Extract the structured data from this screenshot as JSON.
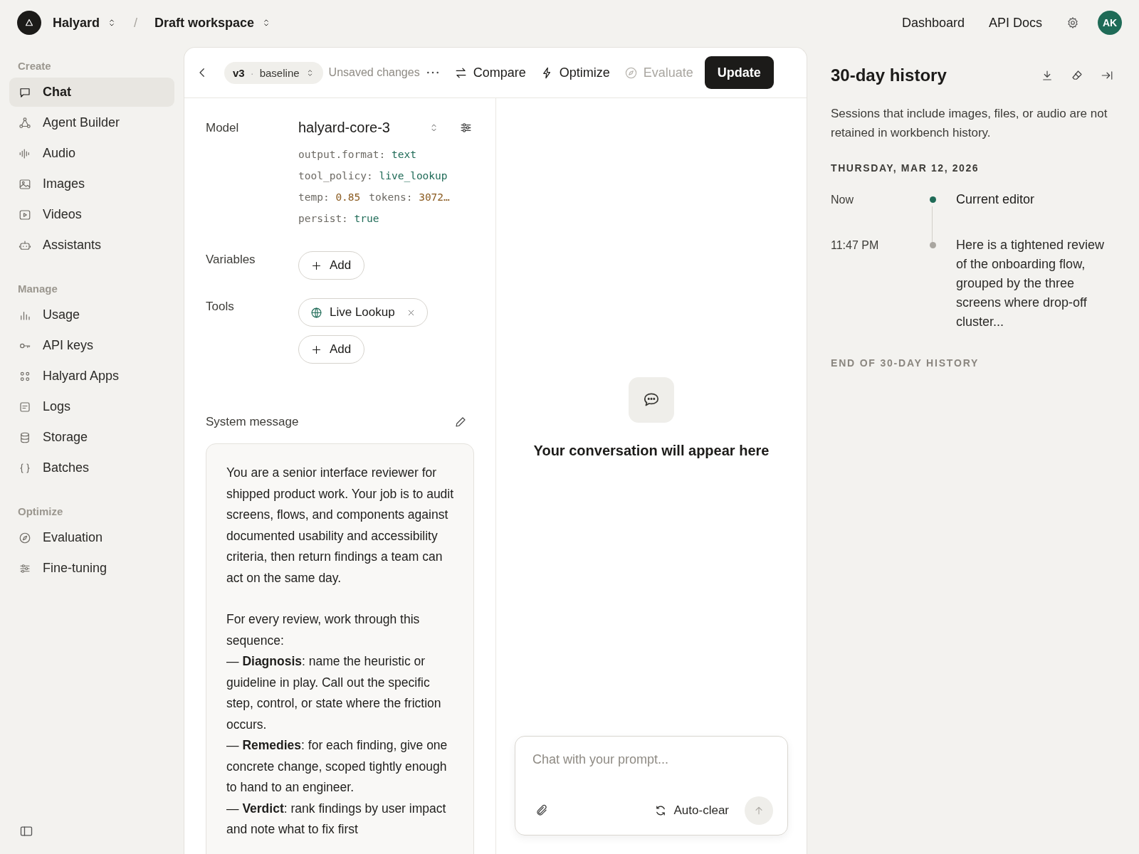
{
  "topbar": {
    "org": "Halyard",
    "separator": "/",
    "workspace": "Draft workspace",
    "links": [
      "Dashboard",
      "API Docs"
    ],
    "avatar": "AK"
  },
  "sidebar": {
    "sections": [
      {
        "title": "Create",
        "items": [
          {
            "label": "Chat",
            "selected": true
          },
          {
            "label": "Agent Builder",
            "selected": false
          },
          {
            "label": "Audio",
            "selected": false
          },
          {
            "label": "Images",
            "selected": false
          },
          {
            "label": "Videos",
            "selected": false
          },
          {
            "label": "Assistants",
            "selected": false
          }
        ]
      },
      {
        "title": "Manage",
        "items": [
          {
            "label": "Usage",
            "selected": false
          },
          {
            "label": "API keys",
            "selected": false
          },
          {
            "label": "Halyard Apps",
            "selected": false
          },
          {
            "label": "Logs",
            "selected": false
          },
          {
            "label": "Storage",
            "selected": false
          },
          {
            "label": "Batches",
            "selected": false
          }
        ]
      },
      {
        "title": "Optimize",
        "items": [
          {
            "label": "Evaluation",
            "selected": false
          },
          {
            "label": "Fine-tuning",
            "selected": false
          }
        ]
      }
    ]
  },
  "toolbar": {
    "version": "v3",
    "version_separator": "·",
    "branch": "baseline",
    "status": "Unsaved changes",
    "actions": [
      {
        "label": "Compare",
        "disabled": false
      },
      {
        "label": "Optimize",
        "disabled": false
      },
      {
        "label": "Evaluate",
        "disabled": true
      }
    ],
    "primary": "Update"
  },
  "config": {
    "model_label": "Model",
    "model": "halyard-core-3",
    "params": [
      [
        {
          "key": "output.format:",
          "value": "text",
          "kind": "string"
        }
      ],
      [
        {
          "key": "tool_policy:",
          "value": "live_lookup",
          "kind": "string"
        }
      ],
      [
        {
          "key": "temp:",
          "value": "0.85",
          "kind": "number"
        },
        {
          "key": "tokens:",
          "value": "3072…",
          "kind": "number"
        }
      ],
      [
        {
          "key": "persist:",
          "value": "true",
          "kind": "string"
        }
      ]
    ],
    "variables_label": "Variables",
    "variables_add": "Add",
    "tools_label": "Tools",
    "tools": [
      {
        "label": "Live Lookup"
      }
    ],
    "tools_add": "Add"
  },
  "system_message": {
    "label": "System message",
    "blocks": [
      {
        "kind": "paragraph",
        "text": "You are a senior interface reviewer for shipped product work. Your job is to audit screens, flows, and components against documented usability and accessibility criteria, then return findings a team can act on the same day."
      },
      {
        "kind": "paragraph",
        "text": "For every review, work through this sequence:"
      },
      {
        "kind": "step",
        "text": "— **Diagnosis**: name the heuristic or guideline in play. Call out the specific step, control, or state where the friction occurs."
      },
      {
        "kind": "step",
        "text": "— **Remedies**: for each finding, give one concrete change, scoped tightly enough to hand to an engineer."
      },
      {
        "kind": "step",
        "text": "— **Verdict**: rank findings by user impact and note what to fix first"
      }
    ]
  },
  "chat": {
    "empty_title": "Your conversation will appear here",
    "placeholder": "Chat with your prompt...",
    "auto_clear": "Auto-clear",
    "send_disabled": true
  },
  "history": {
    "title": "30-day history",
    "note": "Sessions that include images, files, or audio are not retained in workbench history.",
    "date": "THURSDAY, MAR 12, 2026",
    "entries": [
      {
        "time": "Now",
        "text": "Current editor",
        "current": true
      },
      {
        "time": "11:47 PM",
        "text": "Here is a tightened review of the onboarding flow, grouped by the three screens where drop-off cluster...",
        "current": false
      }
    ],
    "end": "END OF 30-DAY HISTORY"
  }
}
